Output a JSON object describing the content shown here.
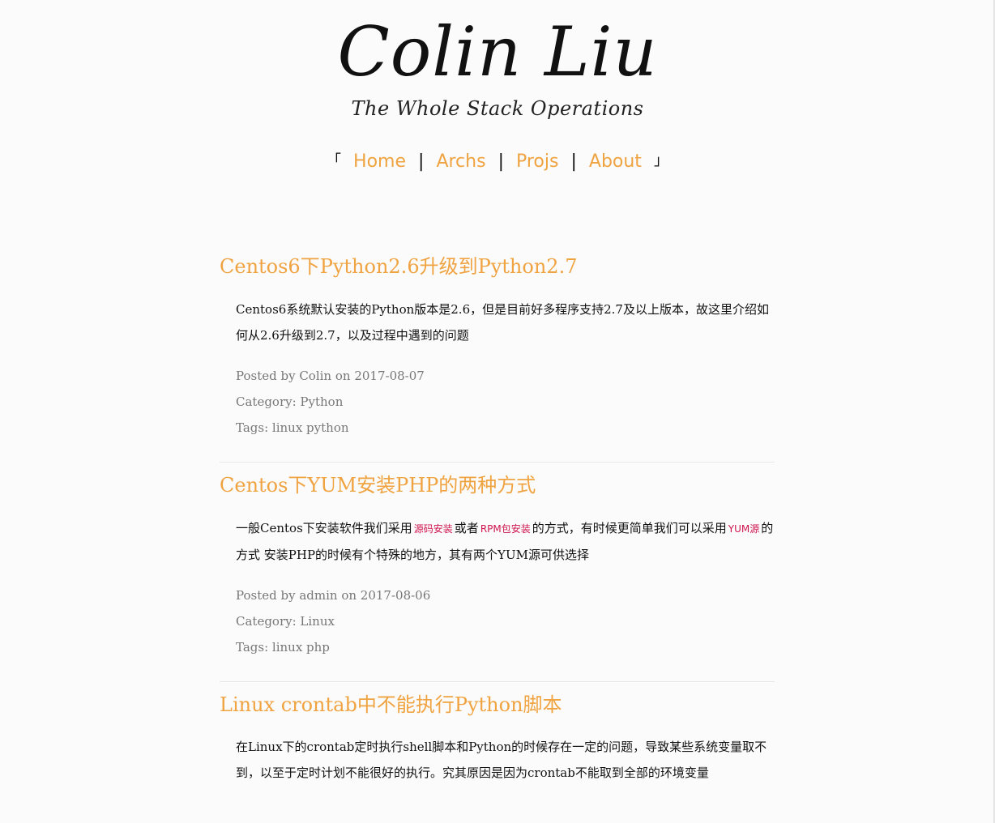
{
  "header": {
    "title": "Colin Liu",
    "subtitle": "The Whole Stack Operations"
  },
  "nav": {
    "open_bracket": "「",
    "close_bracket": "」",
    "separator": "|",
    "items": [
      {
        "label": "Home"
      },
      {
        "label": "Archs"
      },
      {
        "label": "Projs"
      },
      {
        "label": "About"
      }
    ]
  },
  "posts": [
    {
      "title": "Centos6下Python2.6升级到Python2.7",
      "summary": "Centos6系统默认安装的Python版本是2.6，但是目前好多程序支持2.7及以上版本，故这里介绍如何从2.6升级到2.7，以及过程中遇到的问题",
      "posted": "Posted by Colin on 2017-08-07",
      "category": "Category: Python",
      "tags": "Tags: linux python"
    },
    {
      "title": "Centos下YUM安装PHP的两种方式",
      "summary_part1": "一般Centos下安装软件我们采用",
      "code1": "源码安装",
      "summary_part2": "或者",
      "code2": "RPM包安装",
      "summary_part3": "的方式，有时候更简单我们可以采用",
      "code3": "YUM源",
      "summary_part4": "的方式 安装PHP的时候有个特殊的地方，其有两个YUM源可供选择",
      "posted": "Posted by admin on 2017-08-06",
      "category": "Category: Linux",
      "tags": "Tags: linux php"
    },
    {
      "title": "Linux crontab中不能执行Python脚本",
      "summary": "在Linux下的crontab定时执行shell脚本和Python的时候存在一定的问题，导致某些系统变量取不到，以至于定时计划不能很好的执行。究其原因是因为crontab不能取到全部的环境变量"
    }
  ],
  "colors": {
    "accent": "#f0a341",
    "code": "#d0144f",
    "meta": "#777777"
  }
}
